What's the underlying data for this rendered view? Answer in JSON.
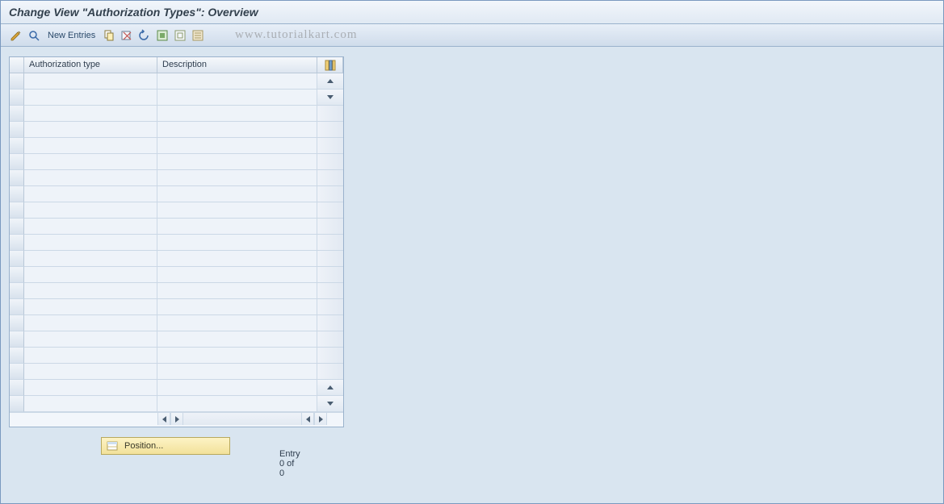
{
  "header": {
    "title": "Change View \"Authorization Types\": Overview"
  },
  "toolbar": {
    "new_entries_label": "New Entries"
  },
  "watermark": "www.tutorialkart.com",
  "table": {
    "columns": {
      "auth_type": "Authorization type",
      "description": "Description"
    },
    "row_count": 21
  },
  "footer": {
    "position_label": "Position...",
    "entry_text": "Entry 0 of 0"
  }
}
